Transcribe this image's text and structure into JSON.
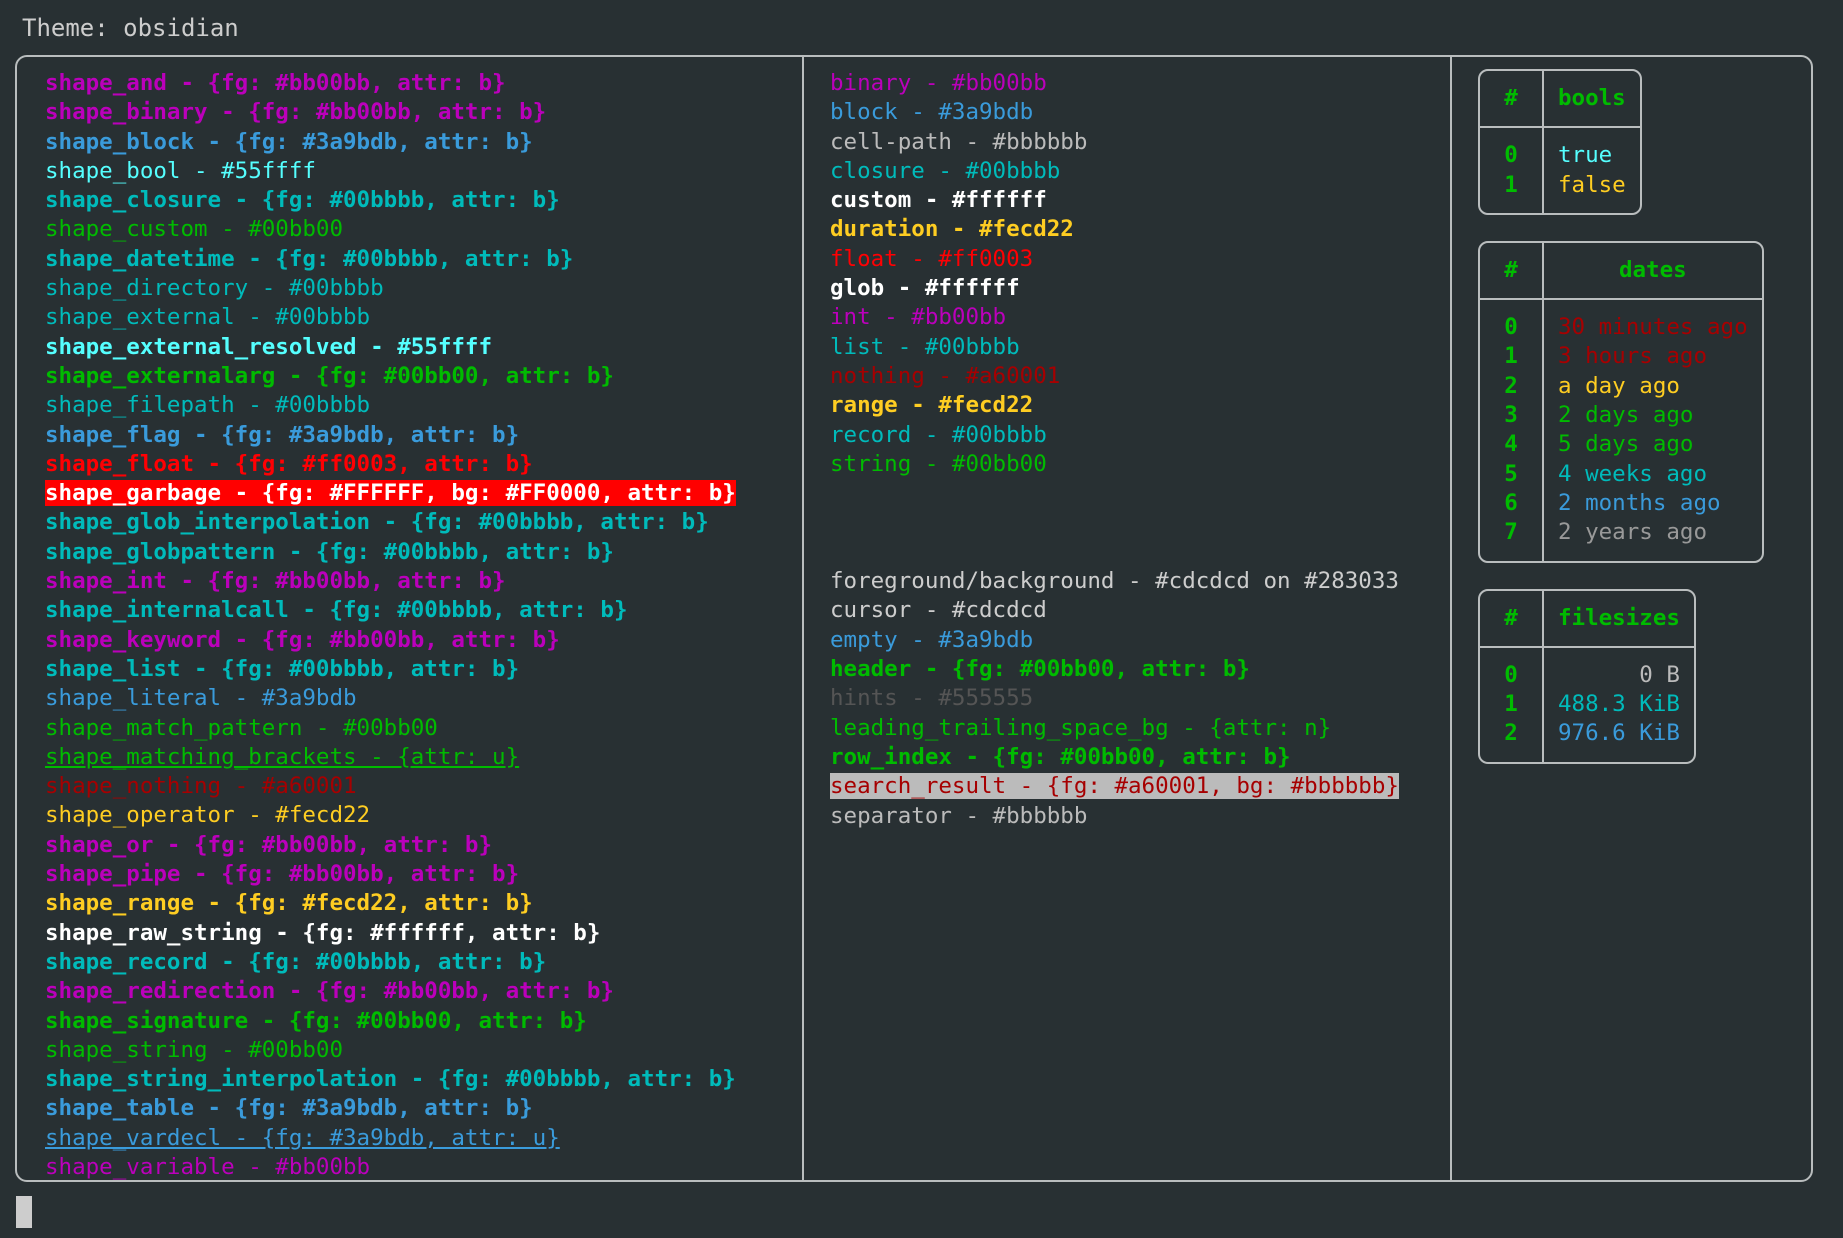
{
  "header": {
    "title": "Theme: obsidian"
  },
  "colors": {
    "background": "#283033",
    "foreground": "#cdcdcd",
    "border": "#b9bdbe",
    "magenta": "#bb00bb",
    "blue": "#3a9bdb",
    "cyan_bright": "#55ffff",
    "cyan": "#00bbbb",
    "green": "#00bb00",
    "red": "#ff0003",
    "dark_red": "#a60001",
    "yellow": "#fecd22",
    "white": "#ffffff",
    "grey": "#bbbbbb",
    "dim_grey": "#555555"
  },
  "shapes": [
    {
      "name": "shape_and",
      "sep": " - ",
      "value": "{fg: #bb00bb, attr: b}",
      "fg": "#bb00bb",
      "bold": true
    },
    {
      "name": "shape_binary",
      "sep": " - ",
      "value": "{fg: #bb00bb, attr: b}",
      "fg": "#bb00bb",
      "bold": true
    },
    {
      "name": "shape_block",
      "sep": " - ",
      "value": "{fg: #3a9bdb, attr: b}",
      "fg": "#3a9bdb",
      "bold": true
    },
    {
      "name": "shape_bool",
      "sep": " - ",
      "value": "#55ffff",
      "fg": "#55ffff",
      "bold": false
    },
    {
      "name": "shape_closure",
      "sep": " - ",
      "value": "{fg: #00bbbb, attr: b}",
      "fg": "#00bbbb",
      "bold": true
    },
    {
      "name": "shape_custom",
      "sep": " - ",
      "value": "#00bb00",
      "fg": "#00bb00",
      "bold": false
    },
    {
      "name": "shape_datetime",
      "sep": " - ",
      "value": "{fg: #00bbbb, attr: b}",
      "fg": "#00bbbb",
      "bold": true
    },
    {
      "name": "shape_directory",
      "sep": " - ",
      "value": "#00bbbb",
      "fg": "#00bbbb",
      "bold": false
    },
    {
      "name": "shape_external",
      "sep": " - ",
      "value": "#00bbbb",
      "fg": "#00bbbb",
      "bold": false
    },
    {
      "name": "shape_external_resolved",
      "sep": " - ",
      "value": "#55ffff",
      "fg": "#55ffff",
      "bold": true
    },
    {
      "name": "shape_externalarg",
      "sep": " - ",
      "value": "{fg: #00bb00, attr: b}",
      "fg": "#00bb00",
      "bold": true
    },
    {
      "name": "shape_filepath",
      "sep": " - ",
      "value": "#00bbbb",
      "fg": "#00bbbb",
      "bold": false
    },
    {
      "name": "shape_flag",
      "sep": " - ",
      "value": "{fg: #3a9bdb, attr: b}",
      "fg": "#3a9bdb",
      "bold": true
    },
    {
      "name": "shape_float",
      "sep": " - ",
      "value": "{fg: #ff0003, attr: b}",
      "fg": "#ff0003",
      "bold": true
    },
    {
      "name": "shape_garbage",
      "sep": " - ",
      "value": "{fg: #FFFFFF, bg: #FF0000, attr: b}",
      "fg": "#ffffff",
      "bg": "#ff0000",
      "bold": true
    },
    {
      "name": "shape_glob_interpolation",
      "sep": " - ",
      "value": "{fg: #00bbbb, attr: b}",
      "fg": "#00bbbb",
      "bold": true
    },
    {
      "name": "shape_globpattern",
      "sep": " - ",
      "value": "{fg: #00bbbb, attr: b}",
      "fg": "#00bbbb",
      "bold": true
    },
    {
      "name": "shape_int",
      "sep": " - ",
      "value": "{fg: #bb00bb, attr: b}",
      "fg": "#bb00bb",
      "bold": true
    },
    {
      "name": "shape_internalcall",
      "sep": " - ",
      "value": "{fg: #00bbbb, attr: b}",
      "fg": "#00bbbb",
      "bold": true
    },
    {
      "name": "shape_keyword",
      "sep": " - ",
      "value": "{fg: #bb00bb, attr: b}",
      "fg": "#bb00bb",
      "bold": true
    },
    {
      "name": "shape_list",
      "sep": " - ",
      "value": "{fg: #00bbbb, attr: b}",
      "fg": "#00bbbb",
      "bold": true
    },
    {
      "name": "shape_literal",
      "sep": " - ",
      "value": "#3a9bdb",
      "fg": "#3a9bdb",
      "bold": false
    },
    {
      "name": "shape_match_pattern",
      "sep": " - ",
      "value": "#00bb00",
      "fg": "#00bb00",
      "bold": false
    },
    {
      "name": "shape_matching_brackets",
      "sep": " - ",
      "value": "{attr: u}",
      "fg": "#00bb00",
      "bold": false,
      "underline": true
    },
    {
      "name": "shape_nothing",
      "sep": " - ",
      "value": "#a60001",
      "fg": "#a60001",
      "bold": false
    },
    {
      "name": "shape_operator",
      "sep": " - ",
      "value": "#fecd22",
      "fg": "#fecd22",
      "bold": false
    },
    {
      "name": "shape_or",
      "sep": " - ",
      "value": "{fg: #bb00bb, attr: b}",
      "fg": "#bb00bb",
      "bold": true
    },
    {
      "name": "shape_pipe",
      "sep": " - ",
      "value": "{fg: #bb00bb, attr: b}",
      "fg": "#bb00bb",
      "bold": true
    },
    {
      "name": "shape_range",
      "sep": " - ",
      "value": "{fg: #fecd22, attr: b}",
      "fg": "#fecd22",
      "bold": true
    },
    {
      "name": "shape_raw_string",
      "sep": " - ",
      "value": "{fg: #ffffff, attr: b}",
      "fg": "#ffffff",
      "bold": true
    },
    {
      "name": "shape_record",
      "sep": " - ",
      "value": "{fg: #00bbbb, attr: b}",
      "fg": "#00bbbb",
      "bold": true
    },
    {
      "name": "shape_redirection",
      "sep": " - ",
      "value": "{fg: #bb00bb, attr: b}",
      "fg": "#bb00bb",
      "bold": true
    },
    {
      "name": "shape_signature",
      "sep": " - ",
      "value": "{fg: #00bb00, attr: b}",
      "fg": "#00bb00",
      "bold": true
    },
    {
      "name": "shape_string",
      "sep": " - ",
      "value": "#00bb00",
      "fg": "#00bb00",
      "bold": false
    },
    {
      "name": "shape_string_interpolation",
      "sep": " - ",
      "value": "{fg: #00bbbb, attr: b}",
      "fg": "#00bbbb",
      "bold": true
    },
    {
      "name": "shape_table",
      "sep": " - ",
      "value": "{fg: #3a9bdb, attr: b}",
      "fg": "#3a9bdb",
      "bold": true
    },
    {
      "name": "shape_vardecl",
      "sep": " - ",
      "value": "{fg: #3a9bdb, attr: u}",
      "fg": "#3a9bdb",
      "bold": false,
      "underline": true
    },
    {
      "name": "shape_variable",
      "sep": " - ",
      "value": "#bb00bb",
      "fg": "#bb00bb",
      "bold": false
    }
  ],
  "types": [
    {
      "name": "binary",
      "sep": " - ",
      "value": "#bb00bb",
      "fg": "#bb00bb",
      "bold": false
    },
    {
      "name": "block",
      "sep": " - ",
      "value": "#3a9bdb",
      "fg": "#3a9bdb",
      "bold": false
    },
    {
      "name": "cell-path",
      "sep": " - ",
      "value": "#bbbbbb",
      "fg": "#bbbbbb",
      "bold": false
    },
    {
      "name": "closure",
      "sep": " - ",
      "value": "#00bbbb",
      "fg": "#00bbbb",
      "bold": false
    },
    {
      "name": "custom",
      "sep": " - ",
      "value": "#ffffff",
      "fg": "#ffffff",
      "bold": true
    },
    {
      "name": "duration",
      "sep": " - ",
      "value": "#fecd22",
      "fg": "#fecd22",
      "bold": true
    },
    {
      "name": "float",
      "sep": " - ",
      "value": "#ff0003",
      "fg": "#ff0003",
      "bold": false
    },
    {
      "name": "glob",
      "sep": " - ",
      "value": "#ffffff",
      "fg": "#ffffff",
      "bold": true
    },
    {
      "name": "int",
      "sep": " - ",
      "value": "#bb00bb",
      "fg": "#bb00bb",
      "bold": false
    },
    {
      "name": "list",
      "sep": " - ",
      "value": "#00bbbb",
      "fg": "#00bbbb",
      "bold": false
    },
    {
      "name": "nothing",
      "sep": " - ",
      "value": "#a60001",
      "fg": "#a60001",
      "bold": false
    },
    {
      "name": "range",
      "sep": " - ",
      "value": "#fecd22",
      "fg": "#fecd22",
      "bold": true
    },
    {
      "name": "record",
      "sep": " - ",
      "value": "#00bbbb",
      "fg": "#00bbbb",
      "bold": false
    },
    {
      "name": "string",
      "sep": " - ",
      "value": "#00bb00",
      "fg": "#00bb00",
      "bold": false
    }
  ],
  "ui_elements": [
    {
      "name": "foreground/background",
      "sep": " - ",
      "value": "#cdcdcd on #283033",
      "fg": "#cdcdcd",
      "bold": false
    },
    {
      "name": "cursor",
      "sep": " - ",
      "value": "#cdcdcd",
      "fg": "#cdcdcd",
      "bold": false
    },
    {
      "name": "empty",
      "sep": " - ",
      "value": "#3a9bdb",
      "fg": "#3a9bdb",
      "bold": false
    },
    {
      "name": "header",
      "sep": " - ",
      "value": "{fg: #00bb00, attr: b}",
      "fg": "#00bb00",
      "bold": true
    },
    {
      "name": "hints",
      "sep": " - ",
      "value": "#555555",
      "fg": "#555555",
      "bold": false
    },
    {
      "name": "leading_trailing_space_bg",
      "sep": " - ",
      "value": "{attr: n}",
      "fg": "#00bb00",
      "bold": false
    },
    {
      "name": "row_index",
      "sep": " - ",
      "value": "{fg: #00bb00, attr: b}",
      "fg": "#00bb00",
      "bold": true
    },
    {
      "name": "search_result",
      "sep": " - ",
      "value": "{fg: #a60001, bg: #bbbbbb}",
      "fg": "#a60001",
      "bg": "#bbbbbb",
      "bold": false
    },
    {
      "name": "separator",
      "sep": " - ",
      "value": "#bbbbbb",
      "fg": "#bbbbbb",
      "bold": false
    }
  ],
  "tables": {
    "bools": {
      "index_header": "#",
      "value_header": "bools",
      "rows": [
        {
          "index": "0",
          "value": "true",
          "fg": "#55ffff",
          "bold": false
        },
        {
          "index": "1",
          "value": "false",
          "fg": "#fecd22",
          "bold": false
        }
      ]
    },
    "dates": {
      "index_header": "#",
      "value_header": "dates",
      "rows": [
        {
          "index": "0",
          "value": "30 minutes ago",
          "fg": "#a60001",
          "bold": true
        },
        {
          "index": "1",
          "value": "3 hours ago",
          "fg": "#a60001",
          "bold": false
        },
        {
          "index": "2",
          "value": "a day ago",
          "fg": "#fecd22",
          "bold": true
        },
        {
          "index": "3",
          "value": "2 days ago",
          "fg": "#00bb00",
          "bold": false
        },
        {
          "index": "4",
          "value": "5 days ago",
          "fg": "#00bb00",
          "bold": true
        },
        {
          "index": "5",
          "value": "4 weeks ago",
          "fg": "#00bbbb",
          "bold": false
        },
        {
          "index": "6",
          "value": "2 months ago",
          "fg": "#3a9bdb",
          "bold": false
        },
        {
          "index": "7",
          "value": "2 years ago",
          "fg": "#999999",
          "bold": false
        }
      ]
    },
    "filesizes": {
      "index_header": "#",
      "value_header": "filesizes",
      "rows": [
        {
          "index": "0",
          "value": "0 B",
          "fg": "#bbbbbb",
          "bold": false
        },
        {
          "index": "1",
          "value": "488.3 KiB",
          "fg": "#00bbbb",
          "bold": false
        },
        {
          "index": "2",
          "value": "976.6 KiB",
          "fg": "#3a9bdb",
          "bold": false
        }
      ]
    }
  }
}
